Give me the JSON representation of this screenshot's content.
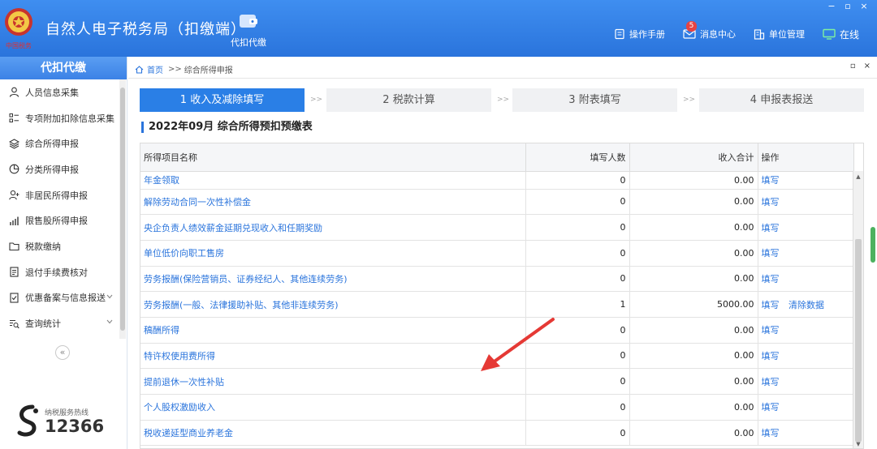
{
  "app": {
    "title": "自然人电子税务局（扣缴端）",
    "logo_text": "中国税务"
  },
  "top_module": {
    "label": "代扣代缴",
    "icon": "wallet-icon"
  },
  "header_actions": [
    {
      "label": "操作手册",
      "icon": "manual-icon"
    },
    {
      "label": "消息中心",
      "icon": "mail-icon",
      "badge": "5"
    },
    {
      "label": "单位管理",
      "icon": "building-icon"
    },
    {
      "label": "在线",
      "icon": "monitor-icon"
    }
  ],
  "window_controls": [
    "−",
    "▫",
    "×"
  ],
  "sidebar": {
    "title": "代扣代缴",
    "items": [
      {
        "label": "人员信息采集",
        "icon": "person-icon"
      },
      {
        "label": "专项附加扣除信息采集",
        "icon": "list-icon"
      },
      {
        "label": "综合所得申报",
        "icon": "layers-icon"
      },
      {
        "label": "分类所得申报",
        "icon": "pie-icon"
      },
      {
        "label": "非居民所得申报",
        "icon": "user-plus-icon"
      },
      {
        "label": "限售股所得申报",
        "icon": "bar-chart-icon"
      },
      {
        "label": "税款缴纳",
        "icon": "folder-icon"
      },
      {
        "label": "退付手续费核对",
        "icon": "document-icon"
      },
      {
        "label": "优惠备案与信息报送",
        "icon": "file-check-icon",
        "expandable": true
      },
      {
        "label": "查询统计",
        "icon": "search-list-icon",
        "expandable": true
      }
    ],
    "collapse": "«",
    "hotline_label": "纳税服务热线",
    "hotline_number": "12366"
  },
  "breadcrumb": {
    "home": "首页",
    "sep": ">>",
    "current": "综合所得申报"
  },
  "panel_controls": [
    "▫",
    "×"
  ],
  "steps": [
    {
      "label": "1 收入及减除填写",
      "active": true
    },
    {
      "label": "2 税款计算",
      "active": false
    },
    {
      "label": "3 附表填写",
      "active": false
    },
    {
      "label": "4 申报表报送",
      "active": false
    }
  ],
  "step_sep": ">>",
  "section_title": "2022年09月  综合所得预扣预缴表",
  "table": {
    "columns": [
      "所得项目名称",
      "填写人数",
      "收入合计",
      "操作"
    ],
    "rows": [
      {
        "name": "年金领取",
        "count": "0",
        "income": "0.00",
        "ops": [
          "填写"
        ]
      },
      {
        "name": "解除劳动合同一次性补偿金",
        "count": "0",
        "income": "0.00",
        "ops": [
          "填写"
        ]
      },
      {
        "name": "央企负责人绩效薪金延期兑现收入和任期奖励",
        "count": "0",
        "income": "0.00",
        "ops": [
          "填写"
        ]
      },
      {
        "name": "单位低价向职工售房",
        "count": "0",
        "income": "0.00",
        "ops": [
          "填写"
        ]
      },
      {
        "name": "劳务报酬(保险营销员、证券经纪人、其他连续劳务)",
        "count": "0",
        "income": "0.00",
        "ops": [
          "填写"
        ]
      },
      {
        "name": "劳务报酬(一般、法律援助补贴、其他非连续劳务)",
        "count": "1",
        "income": "5000.00",
        "ops": [
          "填写",
          "清除数据"
        ]
      },
      {
        "name": "稿酬所得",
        "count": "0",
        "income": "0.00",
        "ops": [
          "填写"
        ]
      },
      {
        "name": "特许权使用费所得",
        "count": "0",
        "income": "0.00",
        "ops": [
          "填写"
        ]
      },
      {
        "name": "提前退休一次性补贴",
        "count": "0",
        "income": "0.00",
        "ops": [
          "填写"
        ]
      },
      {
        "name": "个人股权激励收入",
        "count": "0",
        "income": "0.00",
        "ops": [
          "填写"
        ]
      },
      {
        "name": "税收递延型商业养老金",
        "count": "0",
        "income": "0.00",
        "ops": [
          "填写"
        ]
      }
    ]
  },
  "colors": {
    "header": "#2a74dc",
    "accent": "#2a7fe6",
    "link": "#2a74dc",
    "annotation_arrow": "#e53935"
  }
}
